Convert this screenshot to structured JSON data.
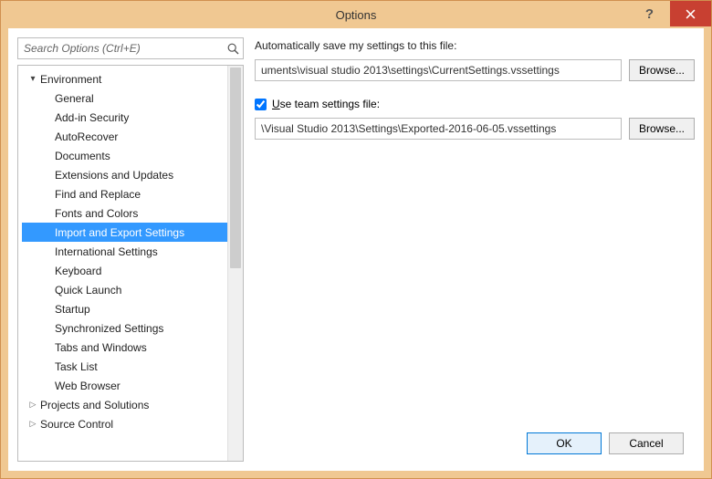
{
  "window": {
    "title": "Options"
  },
  "search": {
    "placeholder": "Search Options (Ctrl+E)"
  },
  "tree": {
    "nodes": [
      {
        "label": "Environment",
        "level": 0,
        "expanded": true
      },
      {
        "label": "General",
        "level": 1
      },
      {
        "label": "Add-in Security",
        "level": 1
      },
      {
        "label": "AutoRecover",
        "level": 1
      },
      {
        "label": "Documents",
        "level": 1
      },
      {
        "label": "Extensions and Updates",
        "level": 1
      },
      {
        "label": "Find and Replace",
        "level": 1
      },
      {
        "label": "Fonts and Colors",
        "level": 1
      },
      {
        "label": "Import and Export Settings",
        "level": 1,
        "selected": true
      },
      {
        "label": "International Settings",
        "level": 1
      },
      {
        "label": "Keyboard",
        "level": 1
      },
      {
        "label": "Quick Launch",
        "level": 1
      },
      {
        "label": "Startup",
        "level": 1
      },
      {
        "label": "Synchronized Settings",
        "level": 1
      },
      {
        "label": "Tabs and Windows",
        "level": 1
      },
      {
        "label": "Task List",
        "level": 1
      },
      {
        "label": "Web Browser",
        "level": 1
      },
      {
        "label": "Projects and Solutions",
        "level": 0,
        "expanded": false
      },
      {
        "label": "Source Control",
        "level": 0,
        "expanded": false
      }
    ]
  },
  "panel": {
    "autoSaveLabel": "Automatically save my settings to this file:",
    "autoSavePath": "uments\\visual studio 2013\\settings\\CurrentSettings.vssettings",
    "browseLabel": "Browse...",
    "useTeamChecked": true,
    "useTeamLabelPrefix": "U",
    "useTeamLabelRest": "se team settings file:",
    "teamPath": "\\Visual Studio 2013\\Settings\\Exported-2016-06-05.vssettings"
  },
  "footer": {
    "ok": "OK",
    "cancel": "Cancel"
  }
}
